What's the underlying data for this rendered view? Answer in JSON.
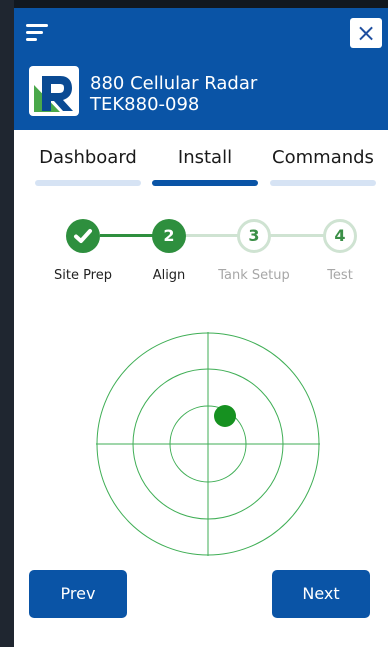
{
  "header": {
    "device_name": "880 Cellular Radar",
    "device_id": "TEK880-098",
    "close_icon": "×",
    "accent_color": "#0a54a6"
  },
  "tabs": [
    {
      "label": "Dashboard",
      "active": false
    },
    {
      "label": "Install",
      "active": true
    },
    {
      "label": "Commands",
      "active": false
    }
  ],
  "steps": [
    {
      "label": "Site Prep",
      "number": "",
      "state": "done"
    },
    {
      "label": "Align",
      "number": "2",
      "state": "current"
    },
    {
      "label": "Tank Setup",
      "number": "3",
      "state": "upcoming"
    },
    {
      "label": "Test",
      "number": "4",
      "state": "upcoming"
    }
  ],
  "radar": {
    "indicator_color": "#169120",
    "ring_color": "#3fae55"
  },
  "buttons": {
    "prev": "Prev",
    "next": "Next"
  }
}
